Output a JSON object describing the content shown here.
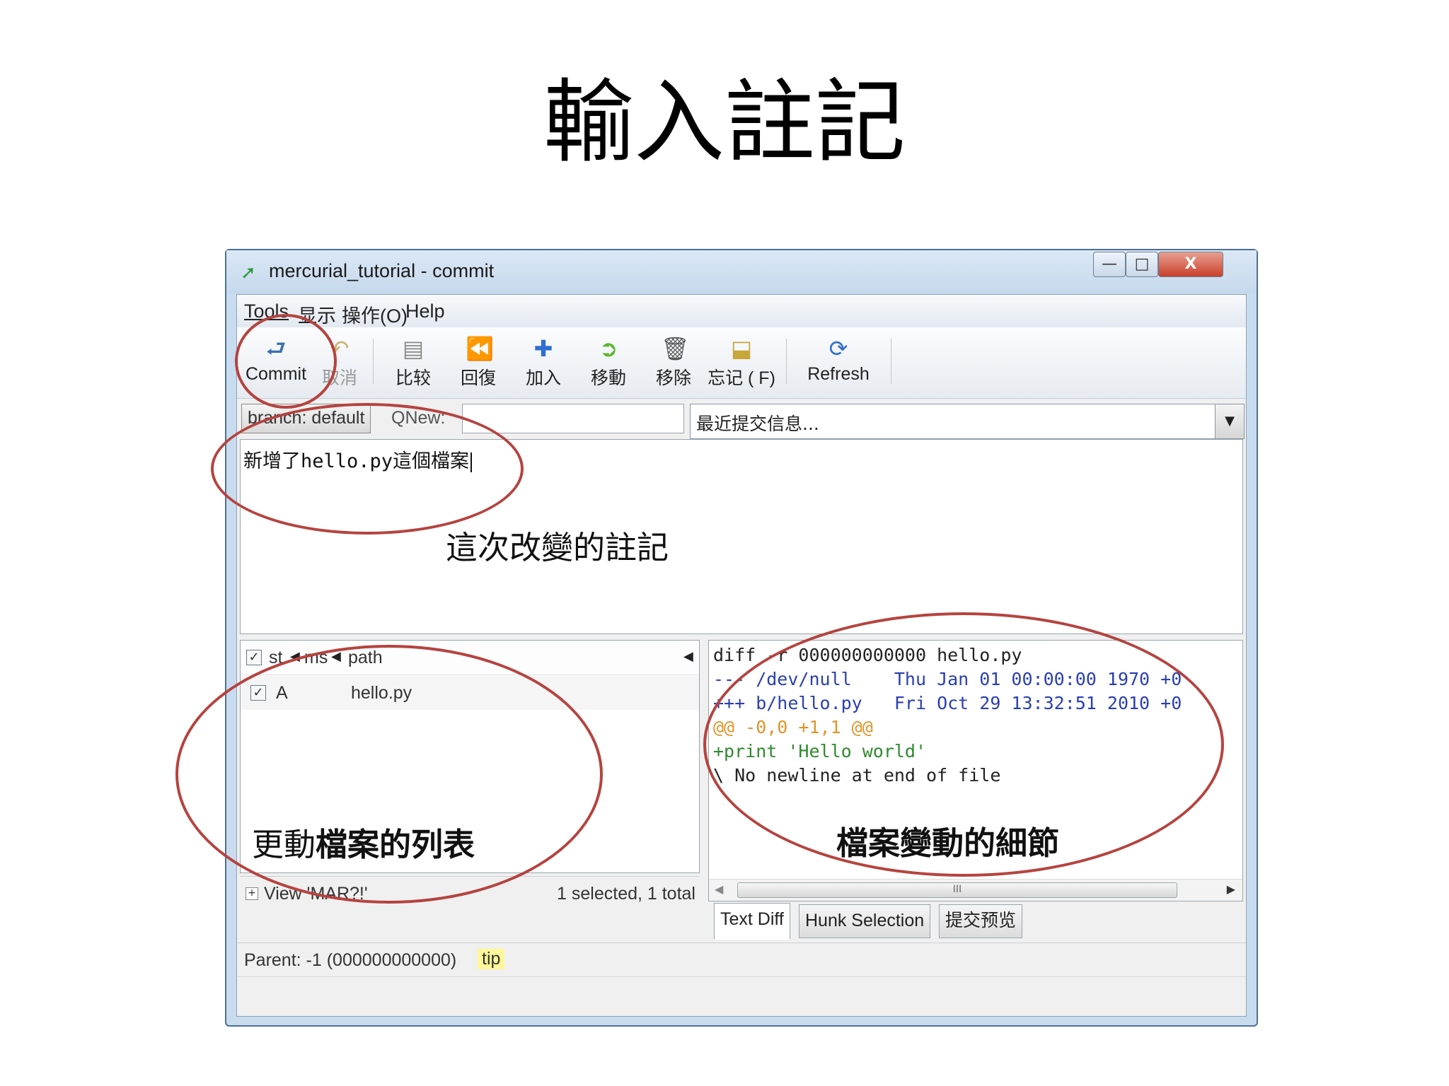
{
  "slide": {
    "title": "輸入註記"
  },
  "window": {
    "title": "mercurial_tutorial - commit",
    "controls": {
      "minimize": "—",
      "maximize": "□",
      "close": "X"
    }
  },
  "menu": [
    "Tools",
    "显示",
    "操作(O)",
    "Help"
  ],
  "toolbar": [
    {
      "label": "Commit",
      "icon": "commit-arrow-icon",
      "enabled": true
    },
    {
      "label": "取消",
      "icon": "undo-icon",
      "enabled": false
    },
    {
      "label": "比较",
      "icon": "document-icon",
      "enabled": true
    },
    {
      "label": "回復",
      "icon": "rewind-icon",
      "enabled": true
    },
    {
      "label": "加入",
      "icon": "plus-icon",
      "enabled": true
    },
    {
      "label": "移動",
      "icon": "move-arrow-icon",
      "enabled": true
    },
    {
      "label": "移除",
      "icon": "trash-can-icon",
      "enabled": true
    },
    {
      "label": "忘记 ( F)",
      "icon": "forget-stamp-icon",
      "enabled": true
    },
    {
      "label": "Refresh",
      "icon": "refresh-icon",
      "enabled": true
    }
  ],
  "branch": {
    "label": "branch: default",
    "qnew_label": "QNew:",
    "qnew_value": "",
    "recent_message": "最近提交信息..."
  },
  "commit_message": "新增了hello.py這個檔案",
  "file_list": {
    "columns": [
      "st",
      "ms",
      "path"
    ],
    "rows": [
      {
        "checked": true,
        "status": "A",
        "ms": "",
        "path": "hello.py"
      }
    ],
    "view_filter": "View 'MAR?!'",
    "count": "1 selected, 1 total"
  },
  "diff": {
    "lines": [
      {
        "text": "diff -r 000000000000 hello.py",
        "color": "#222222"
      },
      {
        "text": "--- /dev/null    Thu Jan 01 00:00:00 1970 +0",
        "color": "#2a3fb0"
      },
      {
        "text": "+++ b/hello.py   Fri Oct 29 13:32:51 2010 +0",
        "color": "#2a3fb0"
      },
      {
        "text": "@@ -0,0 +1,1 @@",
        "color": "#e0952a"
      },
      {
        "text": "+print 'Hello world'",
        "color": "#2f8a2f"
      },
      {
        "text": "\\ No newline at end of file",
        "color": "#222222"
      }
    ],
    "scroll_thumb": "III"
  },
  "tabs": [
    {
      "label": "Text Diff",
      "active": true
    },
    {
      "label": "Hunk Selection",
      "active": false
    },
    {
      "label": "提交预览",
      "active": false
    }
  ],
  "parent": {
    "text": "Parent: -1 (000000000000)",
    "tag": "tip"
  },
  "annotations": {
    "message_note": "這次改變的註記",
    "filelist_note_prefix": "更動",
    "filelist_note_bold": "檔案的列表",
    "diff_note": "檔案變動的細節",
    "circle_color": "#b5433f"
  }
}
